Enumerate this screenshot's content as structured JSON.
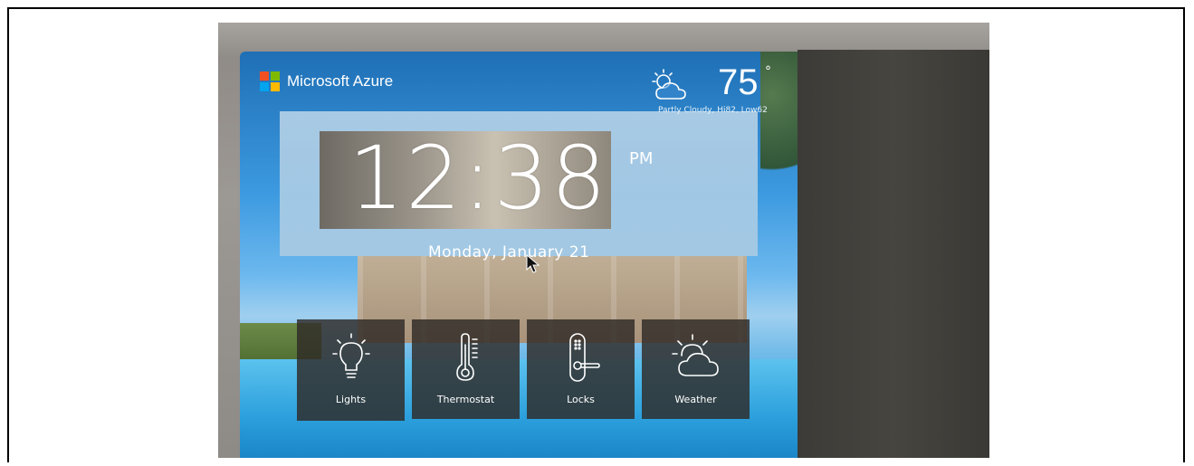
{
  "app": {
    "brand_name": "Microsoft Azure",
    "brand_colors": [
      "#f25022",
      "#7fba00",
      "#00a4ef",
      "#ffb900"
    ]
  },
  "weather": {
    "temperature": "75",
    "degree_symbol": "°",
    "summary": "Partly Cloudy, Hi82, Low62",
    "icon": "partly-cloudy-icon"
  },
  "clock": {
    "time": "12:38",
    "meridiem": "PM",
    "date": "Monday, January 21"
  },
  "tiles": [
    {
      "label": "Lights",
      "icon": "lightbulb-icon"
    },
    {
      "label": "Thermostat",
      "icon": "thermometer-icon"
    },
    {
      "label": "Locks",
      "icon": "door-lock-icon"
    },
    {
      "label": "Weather",
      "icon": "sun-cloud-icon"
    }
  ]
}
